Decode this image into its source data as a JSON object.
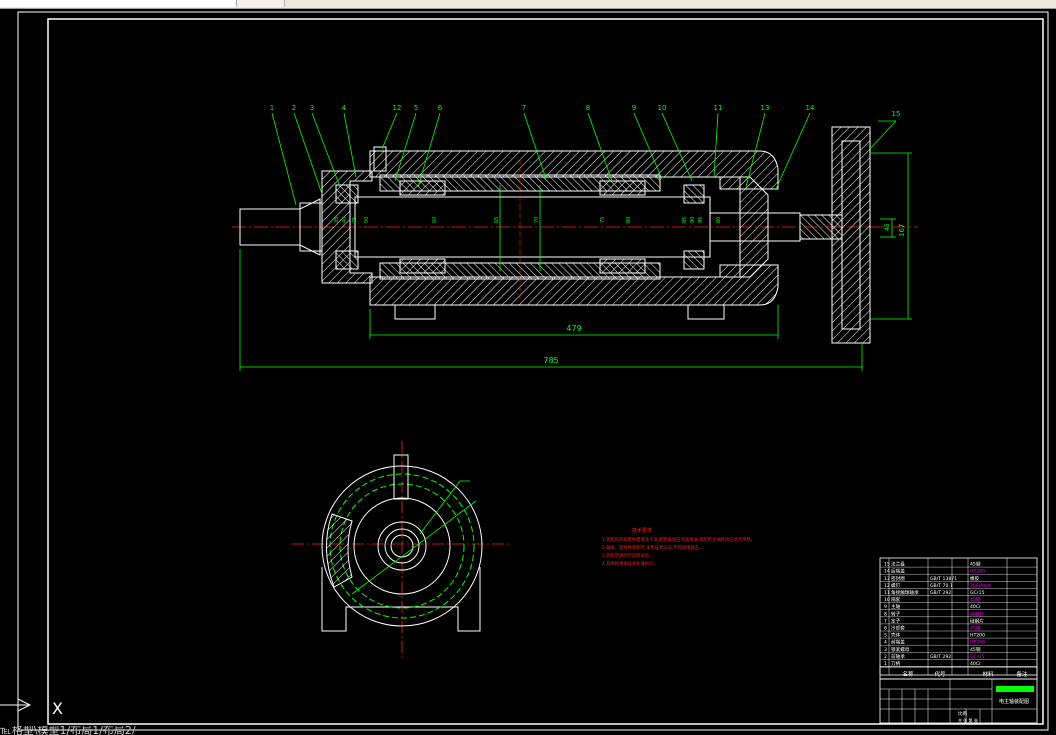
{
  "window": {
    "command_line_text": "℡格型\\模型1/布局1/布局2/"
  },
  "drawing": {
    "part_numbers": [
      "1",
      "2",
      "3",
      "4",
      "12",
      "5",
      "6",
      "7",
      "8",
      "9",
      "10",
      "11",
      "13",
      "14",
      "15"
    ],
    "inner_dims": [
      "35",
      "40",
      "45",
      "50",
      "60",
      "65",
      "70",
      "75",
      "80",
      "85",
      "90",
      "95",
      "80"
    ],
    "dim_479": "479",
    "dim_785": "785",
    "dim_vertical_1": "167",
    "dim_vertical_2": "45",
    "tech_req_title": "技术要求",
    "tech_req_lines": [
      "1.装配前所有零件需清洗干净,配合表面应涂润滑油,装配后主轴转动应灵活平稳。",
      "2.轴承、密封件装配时,采用压装方法,不得直接敲击。",
      "3.装配后进行空运转试验。",
      "4.其余按相关技术标准执行。"
    ],
    "bom_rows": [
      {
        "no": "15",
        "name": "法兰盘",
        "code": "",
        "material": "45钢"
      },
      {
        "no": "14",
        "name": "后端盖",
        "code": "",
        "material": "HT200"
      },
      {
        "no": "13",
        "name": "密封圈",
        "code": "GB/T 13871",
        "material": "橡胶"
      },
      {
        "no": "12",
        "name": "螺钉",
        "code": "GB/T 70.1",
        "material": "35CrMoA"
      },
      {
        "no": "11",
        "name": "角接触球轴承",
        "code": "GB/T 292",
        "material": "GCr15"
      },
      {
        "no": "10",
        "name": "隔套",
        "code": "",
        "material": "45钢"
      },
      {
        "no": "9",
        "name": "主轴",
        "code": "",
        "material": "40Cr"
      },
      {
        "no": "8",
        "name": "转子",
        "code": "",
        "material": "硅钢片"
      },
      {
        "no": "7",
        "name": "定子",
        "code": "",
        "material": "硅钢片"
      },
      {
        "no": "6",
        "name": "冷却套",
        "code": "",
        "material": "45钢"
      },
      {
        "no": "5",
        "name": "壳体",
        "code": "",
        "material": "HT200"
      },
      {
        "no": "4",
        "name": "前端盖",
        "code": "",
        "material": "HT200"
      },
      {
        "no": "3",
        "name": "锁紧螺母",
        "code": "",
        "material": "45钢"
      },
      {
        "no": "2",
        "name": "前轴承",
        "code": "GB/T 292",
        "material": "GCr15"
      },
      {
        "no": "1",
        "name": "刀柄",
        "code": "",
        "material": "40Cr"
      }
    ],
    "bom_header": {
      "seq": "序号",
      "code": "代号",
      "name": "名称",
      "qty": "数量",
      "material": "材料",
      "note": "备注"
    },
    "title_block": {
      "drawing_title": "电主轴装配图",
      "scale_label": "比例",
      "sheet_label": "共 张 第 张"
    }
  },
  "ucs_icon_label": "X",
  "colors": {
    "background": "#000000",
    "outline": "#ffffff",
    "dimension": "#00ff00",
    "centerline": "#ff0000",
    "hatch": "#ffffff",
    "annotation_red": "#ff2020",
    "bom_magenta": "#ff00ff",
    "title_green": "#00ff00"
  }
}
